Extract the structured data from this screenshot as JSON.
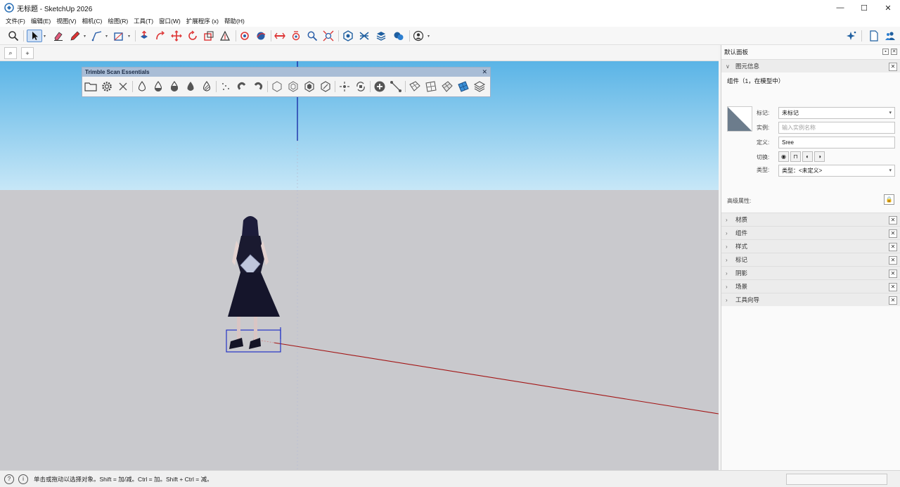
{
  "window": {
    "title": "无标题 - SketchUp 2026",
    "controls": {
      "minimize": "—",
      "maximize": "☐",
      "close": "✕"
    }
  },
  "menubar": {
    "items": [
      "文件(F)",
      "编辑(E)",
      "视图(V)",
      "相机(C)",
      "绘图(R)",
      "工具(T)",
      "窗口(W)",
      "扩展程序 (x)",
      "帮助(H)"
    ]
  },
  "toolbar": {
    "icons": [
      "search-icon",
      "select-icon",
      "eraser-icon",
      "pencil-icon",
      "line-icon",
      "rectangle-icon",
      "push-pull-icon",
      "follow-me-icon",
      "move-icon",
      "rotate-icon",
      "scale-icon",
      "tape-measure-icon",
      "paint-bucket-icon",
      "orbit-icon",
      "pan-icon",
      "zoom-icon",
      "zoom-extents-icon",
      "warehouse-icon",
      "sandbox-icon",
      "layers-icon",
      "chat-icon",
      "account-icon",
      "ai-sparkle-icon",
      "new-file-icon",
      "users-icon"
    ]
  },
  "subbar": {
    "search_glyph": "⌕",
    "add_glyph": "+"
  },
  "floating_toolbar": {
    "title": "Trimble Scan Essentials",
    "close": "✕"
  },
  "panel": {
    "title": "默认面板",
    "entity_info": {
      "header": "图元信息",
      "component_line": "组件（1，在模型中）",
      "tag_label": "标记:",
      "tag_value": "未标记",
      "instance_label": "实例:",
      "instance_placeholder": "输入实例名称",
      "definition_label": "定义:",
      "definition_value": "Sree",
      "toggle_label": "切换:",
      "type_label": "类型:",
      "type_value": "类型：<未定义>",
      "advanced_label": "高级属性:"
    },
    "sections": [
      "材质",
      "组件",
      "样式",
      "标记",
      "阴影",
      "场景",
      "工具向导"
    ]
  },
  "statusbar": {
    "text": "单击或拖动以选择对象。Shift = 加/减。Ctrl = 加。Shift + Ctrl = 减。",
    "icon1": "?",
    "icon2": "i"
  }
}
